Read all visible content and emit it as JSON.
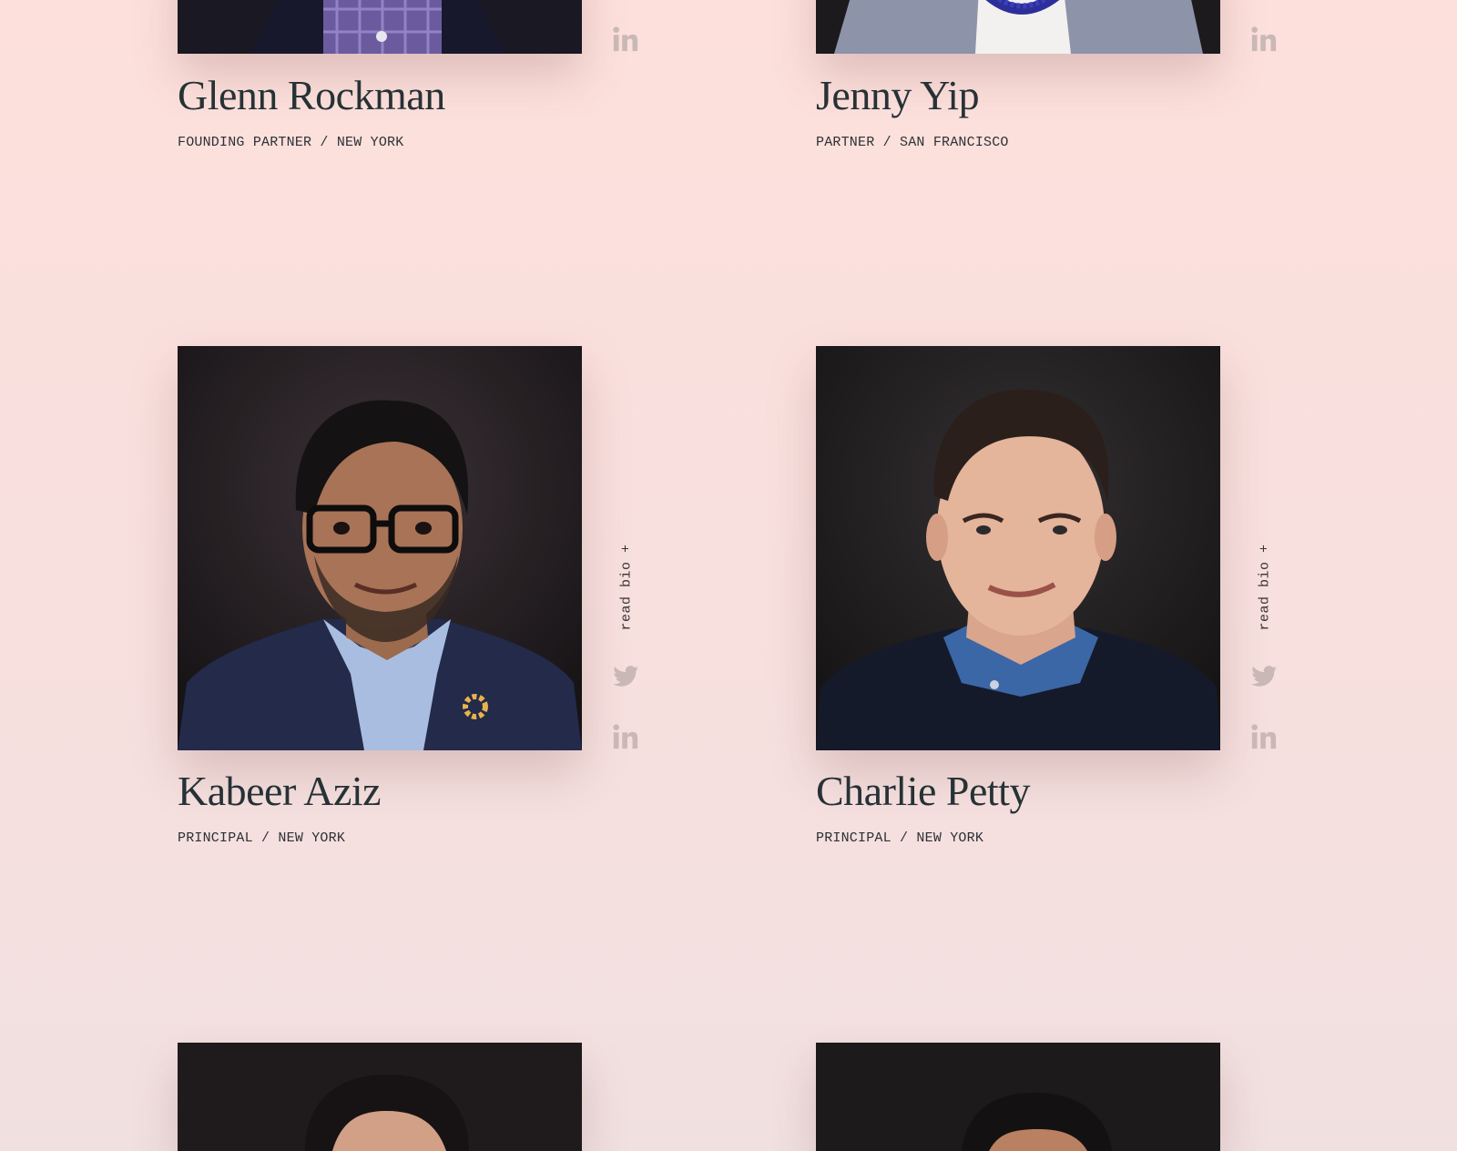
{
  "icons": {
    "linkedin": "linkedin-icon",
    "twitter": "twitter-icon",
    "plus": "plus-icon"
  },
  "colors": {
    "background_top": "#fde0dc",
    "background_bottom": "#f1e0e0",
    "name_text": "#263236",
    "social_icon": "#c9b8b6"
  },
  "team": [
    {
      "name": "Glenn Rockman",
      "role": "FOUNDING PARTNER / NEW YORK"
    },
    {
      "name": "Jenny Yip",
      "role": "PARTNER / SAN FRANCISCO"
    },
    {
      "name": "Kabeer Aziz",
      "role": "PRINCIPAL / NEW YORK",
      "read_bio": "read bio +"
    },
    {
      "name": "Charlie Petty",
      "role": "PRINCIPAL / NEW YORK",
      "read_bio": "read bio +"
    }
  ]
}
